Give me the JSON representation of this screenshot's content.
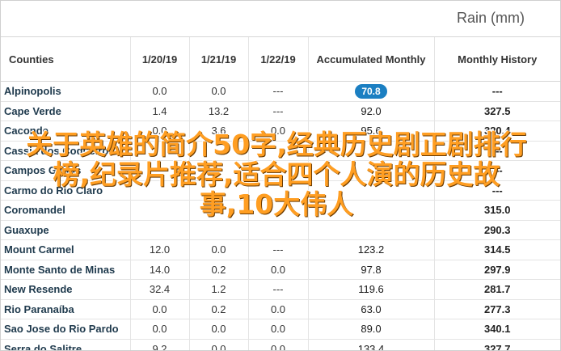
{
  "header": {
    "title": "Rain (mm)"
  },
  "table": {
    "columns": [
      "Counties",
      "1/20/19",
      "1/21/19",
      "1/22/19",
      "Accumulated Monthly",
      "Monthly History"
    ],
    "rows": [
      [
        "Alpinopolis",
        "0.0",
        "0.0",
        "---",
        "70.8",
        "---"
      ],
      [
        "Cape Verde",
        "1.4",
        "13.2",
        "---",
        "92.0",
        "327.5"
      ],
      [
        "Caconde",
        "0.0",
        "3.6",
        "0.0",
        "95.6",
        "320.4"
      ],
      [
        "Cassia dos Coqueiros",
        "",
        "",
        "",
        "",
        "---"
      ],
      [
        "Campos Gerais",
        "",
        "",
        "",
        "",
        "---"
      ],
      [
        "Carmo do Rio Claro",
        "",
        "",
        "",
        "",
        "---"
      ],
      [
        "Coromandel",
        "",
        "",
        "",
        "",
        "315.0"
      ],
      [
        "Guaxupe",
        "",
        "",
        "",
        "",
        "290.3"
      ],
      [
        "Mount Carmel",
        "12.0",
        "0.0",
        "---",
        "123.2",
        "314.5"
      ],
      [
        "Monte Santo de Minas",
        "14.0",
        "0.2",
        "0.0",
        "97.8",
        "297.9"
      ],
      [
        "New Resende",
        "32.4",
        "1.2",
        "---",
        "119.6",
        "281.7"
      ],
      [
        "Rio Paranaíba",
        "0.0",
        "0.2",
        "0.0",
        "63.0",
        "277.3"
      ],
      [
        "Sao Jose do Rio Pardo",
        "0.0",
        "0.0",
        "0.0",
        "89.0",
        "340.1"
      ],
      [
        "Serra do Salitre",
        "9.2",
        "0.0",
        "0.0",
        "133.4",
        "327.7"
      ]
    ]
  },
  "overlay_text": "关于英雄的简介50字,经典历史剧正剧排行榜,纪录片推荐,适合四个人演的历史故事,10大伟人",
  "colors": {
    "accent": "#1b7fc2",
    "overlay": "#ff9e22"
  }
}
